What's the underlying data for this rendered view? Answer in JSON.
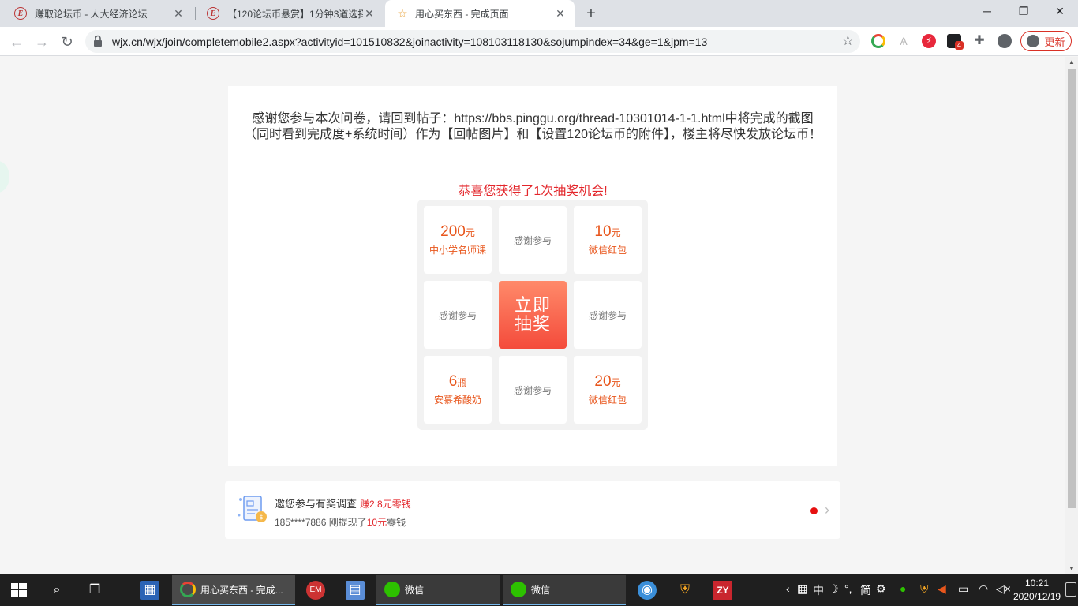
{
  "browser": {
    "tabs": [
      {
        "title": "赚取论坛币 - 人大经济论坛",
        "favicon": "E"
      },
      {
        "title": "【120论坛币悬赏】1分钟3道选择",
        "favicon": "E"
      },
      {
        "title": "用心买东西 - 完成页面",
        "favicon": "star-icon"
      }
    ],
    "url": "wjx.cn/wjx/join/completemobile2.aspx?activityid=101510832&joinactivity=108103118130&sojumpindex=34&ge=1&jpm=13",
    "update_label": "更新",
    "extension_badge": "4"
  },
  "page": {
    "thanks_text": "感谢您参与本次问卷，请回到帖子：https://bbs.pinggu.org/thread-10301014-1-1.html中将完成的截图（同时看到完成度+系统时间）作为【回帖图片】和【设置120论坛币的附件】，楼主将尽快发放论坛币！",
    "congrats": "恭喜您获得了1次抽奖机会!",
    "prizes": {
      "p1": {
        "value": "200",
        "unit": "元",
        "desc": "中小学名师课"
      },
      "p2": {
        "text": "感谢参与"
      },
      "p3": {
        "value": "10",
        "unit": "元",
        "desc": "微信红包"
      },
      "p4": {
        "text": "感谢参与"
      },
      "draw": "立即抽奖",
      "p6": {
        "text": "感谢参与"
      },
      "p7": {
        "value": "6",
        "unit": "瓶",
        "desc": "安慕希酸奶"
      },
      "p8": {
        "text": "感谢参与"
      },
      "p9": {
        "value": "20",
        "unit": "元",
        "desc": "微信红包"
      }
    },
    "promo": {
      "title": "邀您参与有奖调查",
      "earn": "赚2.8元零钱",
      "sub_prefix": "185****7886 刚提现了",
      "sub_amount": "10元",
      "sub_suffix": "零钱"
    }
  },
  "taskbar": {
    "apps": [
      {
        "label": "用心买东西 - 完成..."
      },
      {
        "label": "微信"
      },
      {
        "label": "微信"
      }
    ],
    "tray": {
      "ime_lang": "中",
      "ime_mode": "简"
    },
    "clock_time": "10:21",
    "clock_date": "2020/12/19"
  },
  "colors": {
    "accent_red": "#e3262b",
    "prize_orange": "#e8561c",
    "draw_button": "#f44b3b"
  }
}
